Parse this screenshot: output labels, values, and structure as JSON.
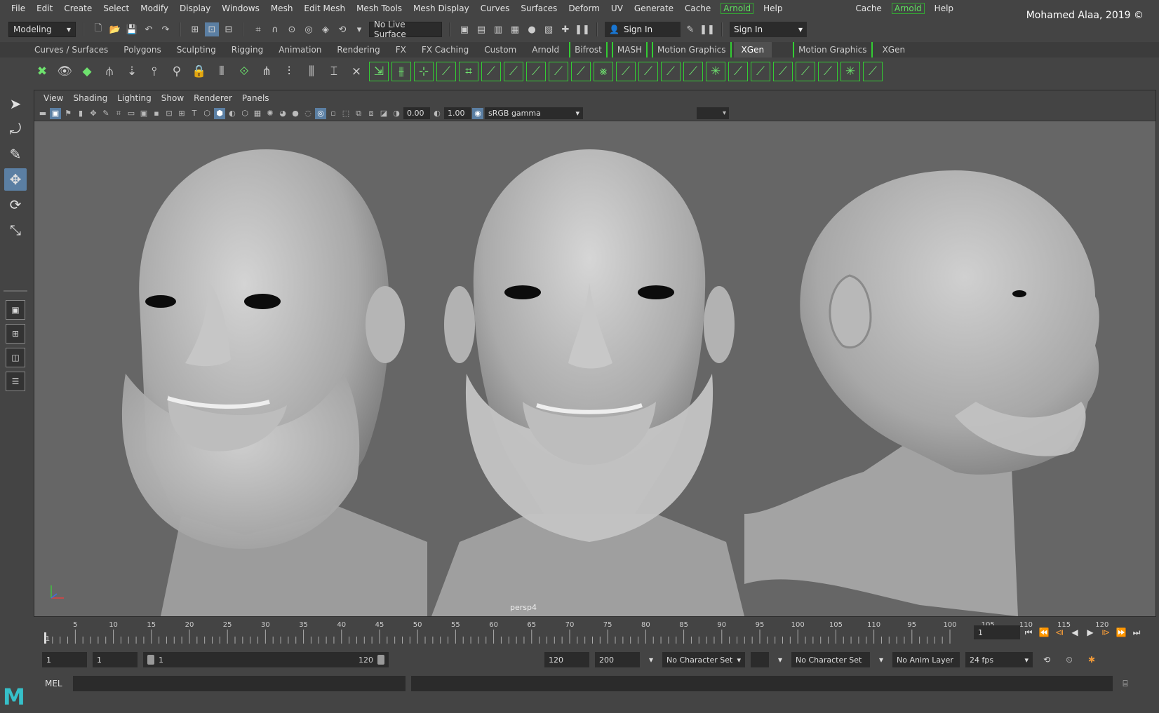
{
  "menubar": {
    "items": [
      "File",
      "Edit",
      "Create",
      "Select",
      "Modify",
      "Display",
      "Windows",
      "Mesh",
      "Edit Mesh",
      "Mesh Tools",
      "Mesh Display",
      "Curves",
      "Surfaces",
      "Deform",
      "UV",
      "Generate",
      "Cache"
    ],
    "arnold": "Arnold",
    "help": "Help",
    "cache2": "Cache",
    "arnold2": "Arnold",
    "help2": "Help"
  },
  "credit": "Mohamed Alaa, 2019 ©",
  "status_line": {
    "workspace": "Modeling",
    "live_surface": "No Live Surface",
    "sign_in": "Sign In",
    "sign_in_2": "Sign In"
  },
  "shelf_tabs": [
    "Curves / Surfaces",
    "Polygons",
    "Sculpting",
    "Rigging",
    "Animation",
    "Rendering",
    "FX",
    "FX Caching",
    "Custom",
    "Arnold",
    "Bifrost",
    "MASH",
    "Motion Graphics",
    "XGen",
    "Motion Graphics",
    "XGen"
  ],
  "panel": {
    "menus": [
      "View",
      "Shading",
      "Lighting",
      "Show",
      "Renderer",
      "Panels"
    ],
    "exposure": "0.00",
    "gamma": "1.00",
    "color_space": "sRGB gamma",
    "camera_label": "persp4"
  },
  "timeline": {
    "ticks": [
      "5",
      "10",
      "15",
      "20",
      "25",
      "30",
      "35",
      "40",
      "45",
      "50",
      "55",
      "60",
      "65",
      "70",
      "75",
      "80",
      "85",
      "90",
      "95",
      "100",
      "105",
      "110",
      "95",
      "100",
      "105",
      "110",
      "115",
      "120"
    ],
    "start_marker": "1",
    "current_frame": "1"
  },
  "range": {
    "start": "1",
    "playback_start": "1",
    "slider_min": "1",
    "slider_max": "120",
    "playback_end": "120",
    "end": "200",
    "character_set": "No Character Set",
    "character_set_2": "No Character Set",
    "anim_layer": "No Anim Layer",
    "fps": "24 fps"
  },
  "command_line": {
    "language": "MEL"
  },
  "colors": {
    "accent": "#5b7fa3",
    "arnold_green": "#5fe05f",
    "key_orange": "#f29a38",
    "maya_logo": "#36c0c9"
  }
}
